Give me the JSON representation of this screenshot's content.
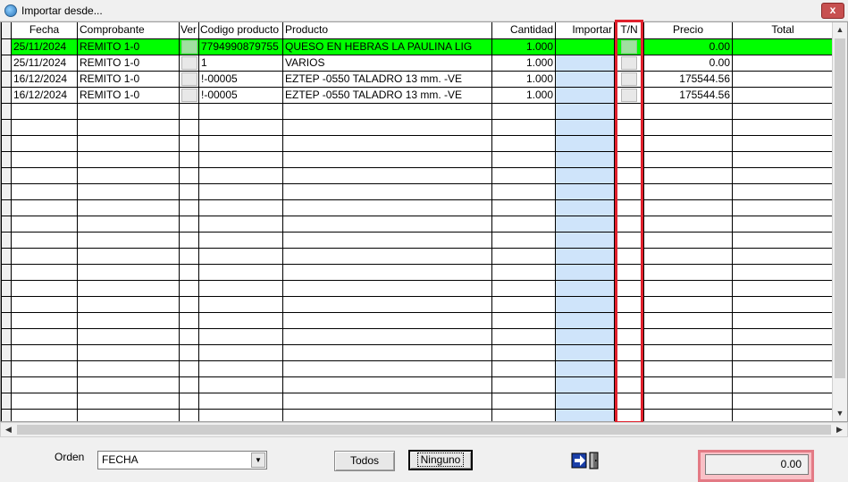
{
  "window": {
    "title": "Importar desde...",
    "close_label": "x"
  },
  "grid": {
    "columns": [
      "Fecha",
      "Comprobante",
      "Ver",
      "Codigo producto",
      "Producto",
      "Cantidad",
      "Importar",
      "T/N",
      "Precio",
      "Total"
    ],
    "rows": [
      {
        "fecha": "25/11/2024",
        "comprobante": "REMITO 1-0",
        "codigo": "7794990879755",
        "producto": "QUESO EN HEBRAS LA PAULINA LIG",
        "cantidad": "1.000",
        "importar": "",
        "precio": "0.00",
        "total": ""
      },
      {
        "fecha": "25/11/2024",
        "comprobante": "REMITO 1-0",
        "codigo": "1",
        "producto": "VARIOS",
        "cantidad": "1.000",
        "importar": "",
        "precio": "0.00",
        "total": ""
      },
      {
        "fecha": "16/12/2024",
        "comprobante": "REMITO 1-0",
        "codigo": "!-00005",
        "producto": "EZTEP -0550 TALADRO 13 mm. -VE",
        "cantidad": "1.000",
        "importar": "",
        "precio": "175544.56",
        "total": ""
      },
      {
        "fecha": "16/12/2024",
        "comprobante": "REMITO 1-0",
        "codigo": "!-00005",
        "producto": "EZTEP -0550 TALADRO 13 mm. -VE",
        "cantidad": "1.000",
        "importar": "",
        "precio": "175544.56",
        "total": ""
      }
    ],
    "selected_row_color": "#00ff00",
    "importar_column_color": "#cfe4fa"
  },
  "footer": {
    "orden_label": "Orden",
    "orden_value": "FECHA",
    "todos_label": "Todos",
    "ninguno_label": "Ninguno",
    "exit_icon": "exit-door-icon",
    "total_value": "0.00"
  },
  "highlights": {
    "tn_column_color": "#e0202c",
    "total_color": "#e37a85"
  }
}
